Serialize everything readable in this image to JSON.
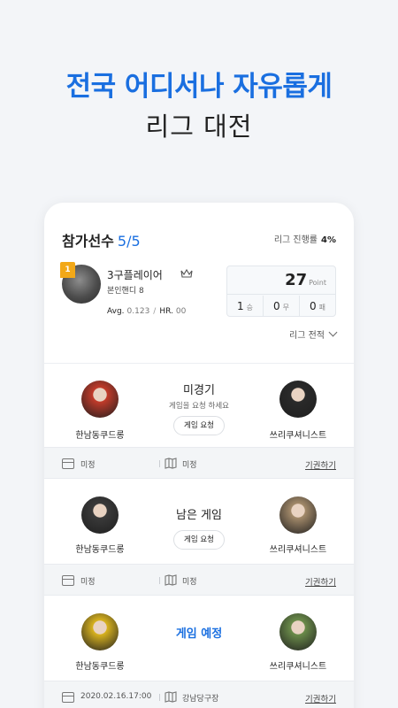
{
  "hero": {
    "line1": "전국 어디서나 자유롭게",
    "line2": "리그 대전"
  },
  "header": {
    "title": "참가선수",
    "count": "5/5",
    "progress_label": "리그 진행률",
    "progress_value": "4%"
  },
  "me": {
    "rank": "1",
    "name": "3구플레이어",
    "handicap": "본인핸디 8",
    "avg_label": "Avg.",
    "avg_value": "0.123",
    "hr_label": "HR.",
    "hr_value": "00",
    "points": "27",
    "points_unit": "Point",
    "wins": "1",
    "wins_unit": "승",
    "draws": "0",
    "draws_unit": "무",
    "losses": "0",
    "losses_unit": "패"
  },
  "record_link": "리그 전적",
  "matches": [
    {
      "left_name": "한남동쿠드롱",
      "right_name": "쓰리쿠셔니스트",
      "title": "미경기",
      "subtitle": "게임을 요청 하세요",
      "button": "게임 요청",
      "date": "미정",
      "place": "미정",
      "forfeit": "기권하기",
      "left_avatar_color": "#c23b2a",
      "right_avatar_color": "#2a2a2a"
    },
    {
      "left_name": "한남동쿠드롱",
      "right_name": "쓰리쿠셔니스트",
      "title": "남은 게임",
      "button": "게임 요청",
      "date": "미정",
      "place": "미정",
      "forfeit": "기권하기",
      "left_avatar_color": "#3a3a3a",
      "right_avatar_color": "#a38a6a"
    },
    {
      "left_name": "한남동쿠드롱",
      "right_name": "쓰리쿠셔니스트",
      "title": "게임 예정",
      "date": "2020.02.16.17:00",
      "place": "강남당구장",
      "forfeit": "기권하기",
      "left_avatar_color": "#d8b21e",
      "right_avatar_color": "#6b8c4a"
    }
  ],
  "colors": {
    "accent": "#1a6fe0",
    "badge": "#f2a818"
  }
}
